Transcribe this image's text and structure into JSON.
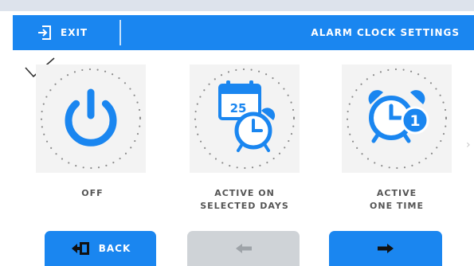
{
  "header": {
    "exit_label": "EXIT",
    "title": "ALARM CLOCK SETTINGS"
  },
  "options": [
    {
      "name": "off",
      "label_lines": [
        "OFF"
      ],
      "icon": "power-icon",
      "selected": true
    },
    {
      "name": "active-on-selected-days",
      "label_lines": [
        "ACTIVE ON",
        "SELECTED DAYS"
      ],
      "icon": "calendar-alarm-icon",
      "calendar_day": "25",
      "selected": false
    },
    {
      "name": "active-one-time",
      "label_lines": [
        "ACTIVE",
        "ONE TIME"
      ],
      "icon": "alarm-clock-one-icon",
      "badge": "1",
      "selected": false
    }
  ],
  "footer": {
    "back_label": "BACK",
    "prev_enabled": false,
    "next_enabled": true
  },
  "colors": {
    "accent": "#1a86f0",
    "disabled": "#cfd3d7",
    "label_text": "#555555",
    "tile_bg": "#f3f3f3"
  }
}
